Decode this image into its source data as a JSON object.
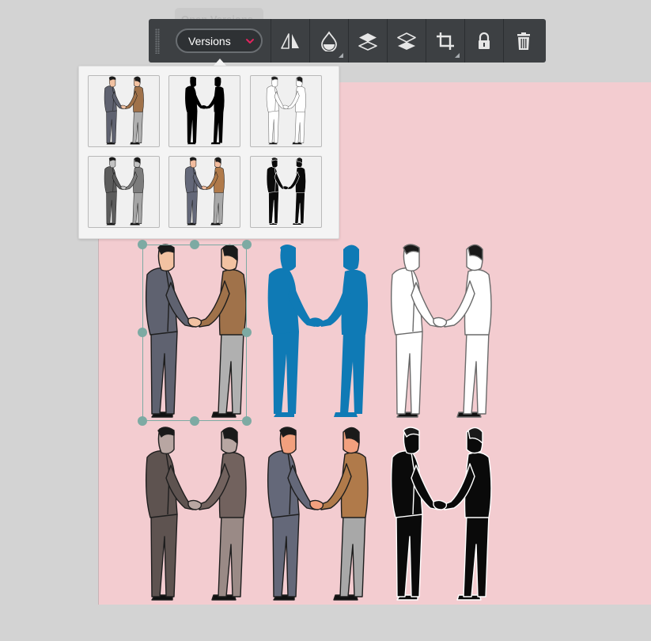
{
  "tooltip": {
    "text": "Open Versions"
  },
  "toolbar": {
    "versions_label": "Versions",
    "accent_color": "#e0245e",
    "tools": [
      {
        "name": "flip-button",
        "icon": "flip-icon"
      },
      {
        "name": "color-button",
        "icon": "drop-icon"
      },
      {
        "name": "bring-forward-button",
        "icon": "layers-up-icon"
      },
      {
        "name": "send-backward-button",
        "icon": "layers-down-icon"
      },
      {
        "name": "crop-button",
        "icon": "crop-icon"
      },
      {
        "name": "lock-button",
        "icon": "lock-icon"
      },
      {
        "name": "delete-button",
        "icon": "trash-icon"
      }
    ]
  },
  "versions": [
    {
      "style": "color",
      "suit": "#5f6270",
      "jacket2": "#a0724a",
      "pants2": "#b0b0b0",
      "skin": "#f2c2a2",
      "line": "#1e1e1e"
    },
    {
      "style": "silhouette",
      "suit": "#000000",
      "jacket2": "#000000",
      "pants2": "#000000",
      "skin": "#000000",
      "line": "#000000"
    },
    {
      "style": "outline",
      "suit": "#ffffff",
      "jacket2": "#ffffff",
      "pants2": "#ffffff",
      "skin": "#ffffff",
      "line": "#6a6a6a"
    },
    {
      "style": "grayscale",
      "suit": "#5c5c5c",
      "jacket2": "#7c7c7c",
      "pants2": "#a5a5a5",
      "skin": "#c2c2c2",
      "line": "#1e1e1e"
    },
    {
      "style": "color-alt",
      "suit": "#646879",
      "jacket2": "#b07a4a",
      "pants2": "#a8a8a8",
      "skin": "#f2bc9e",
      "line": "#1e1e1e"
    },
    {
      "style": "black-line",
      "suit": "#0a0a0a",
      "jacket2": "#0a0a0a",
      "pants2": "#0a0a0a",
      "skin": "#0a0a0a",
      "line": "#ffffff"
    }
  ],
  "canvas_items": [
    {
      "style": "color",
      "suit": "#5f6270",
      "jacket2": "#a0724a",
      "pants2": "#b0b0b0",
      "skin": "#f2c2a2",
      "line": "#1e1e1e"
    },
    {
      "style": "blue-silhouette",
      "suit": "#0f7ab5",
      "jacket2": "#0f7ab5",
      "pants2": "#0f7ab5",
      "skin": "#0f7ab5",
      "line": "#0f7ab5"
    },
    {
      "style": "outline",
      "suit": "#ffffff",
      "jacket2": "#ffffff",
      "pants2": "#ffffff",
      "skin": "#ffffff",
      "line": "#6a6a6a"
    },
    {
      "style": "sepia",
      "suit": "#5e5350",
      "jacket2": "#72625e",
      "pants2": "#9a8a86",
      "skin": "#b8a6a2",
      "line": "#1e1e1e"
    },
    {
      "style": "color-alt",
      "suit": "#646879",
      "jacket2": "#b07a4a",
      "pants2": "#a8a8a8",
      "skin": "#f2a07e",
      "line": "#1e1e1e"
    },
    {
      "style": "black-line",
      "suit": "#0a0a0a",
      "jacket2": "#0a0a0a",
      "pants2": "#0a0a0a",
      "skin": "#0a0a0a",
      "line": "#ffffff"
    }
  ]
}
